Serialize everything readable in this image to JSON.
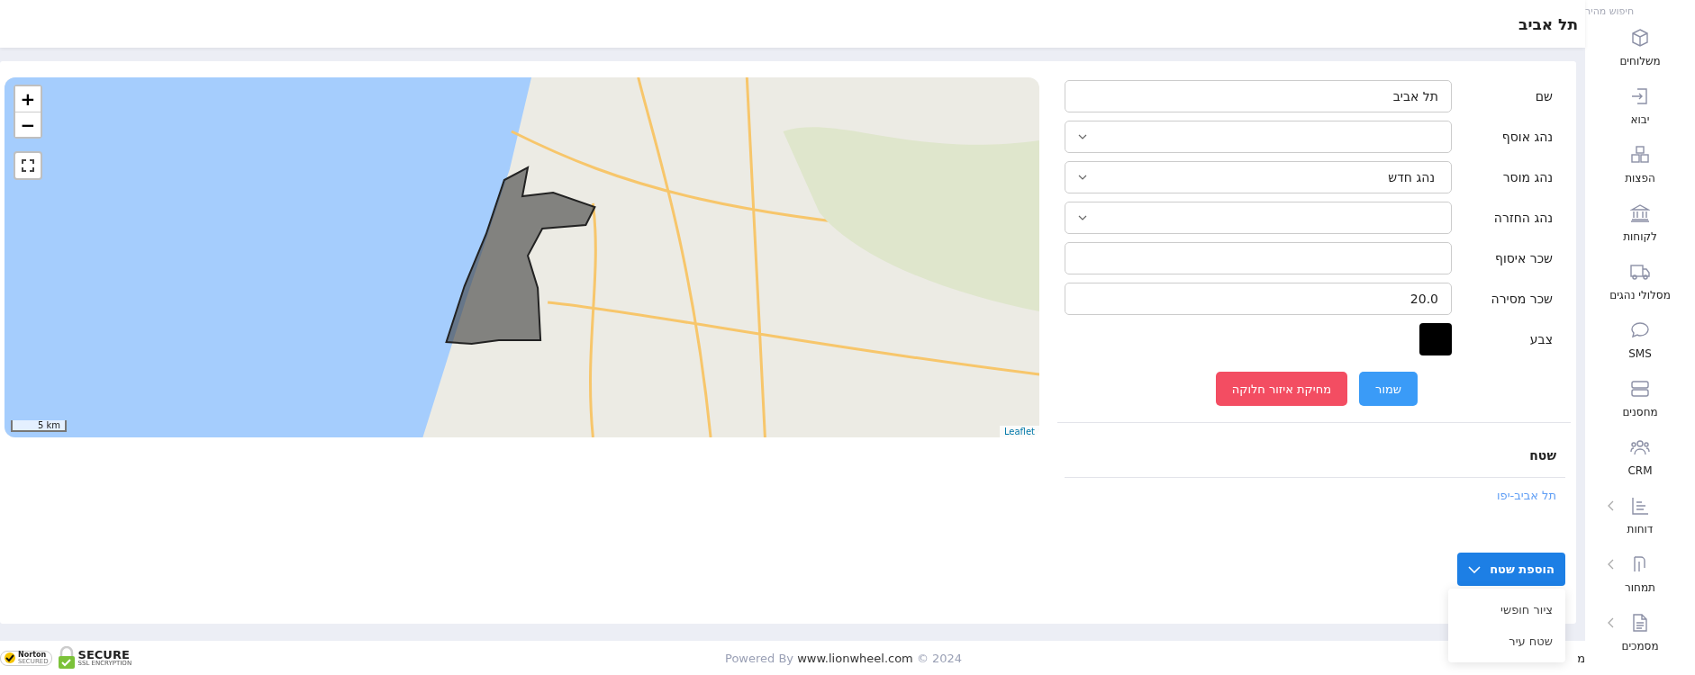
{
  "header": {
    "title": "תל אביב"
  },
  "sidebar": {
    "search_placeholder": "חיפוש מהיר",
    "items": [
      {
        "label": "משלוחים",
        "expandable": false
      },
      {
        "label": "יבוא",
        "expandable": false
      },
      {
        "label": "הפצות",
        "expandable": false
      },
      {
        "label": "לקוחות",
        "expandable": false
      },
      {
        "label": "מסלולי נהגים",
        "expandable": false
      },
      {
        "label": "SMS",
        "expandable": false
      },
      {
        "label": "מחסנים",
        "expandable": false
      },
      {
        "label": "CRM",
        "expandable": false
      },
      {
        "label": "דוחות",
        "expandable": true
      },
      {
        "label": "תמחור",
        "expandable": true
      },
      {
        "label": "מסמכים",
        "expandable": true
      }
    ]
  },
  "map": {
    "zoom_in": "+",
    "zoom_out": "−",
    "scale": "5 km",
    "attribution": "Leaflet"
  },
  "form": {
    "fields": [
      {
        "label": "שם",
        "kind": "text",
        "value": "תל אביב"
      },
      {
        "label": "נהג אוסף",
        "kind": "select"
      },
      {
        "label": "נהג מוסר",
        "kind": "select",
        "value": "נהג חדש"
      },
      {
        "label": "נהג החזרה",
        "kind": "select"
      },
      {
        "label": "שכר איסוף",
        "kind": "text"
      },
      {
        "label": "שכר מסירה",
        "kind": "text",
        "value": "20.0"
      },
      {
        "label": "צבע",
        "kind": "color",
        "color": "#000000"
      }
    ],
    "buttons": [
      {
        "label": "שמור",
        "kind": "primary"
      },
      {
        "label": "מחיקת איזור חלוקה",
        "kind": "danger"
      }
    ]
  },
  "areas": {
    "heading": "שטח",
    "items": [
      "תל אביב-יפו"
    ],
    "add_button": {
      "label": "הוספת שטח",
      "expanded": true
    },
    "menu": [
      "ציור חופשי",
      "שטח עיר"
    ]
  },
  "footer": {
    "powered_by": "Powered By",
    "site": "www.lionwheel.com",
    "copyright": "© 2024",
    "norton": "Norton",
    "norton_sub": "SECURED",
    "secure": "SECURE",
    "secure_sub": "SSL ENCRYPTION",
    "cut_text": "מ"
  }
}
